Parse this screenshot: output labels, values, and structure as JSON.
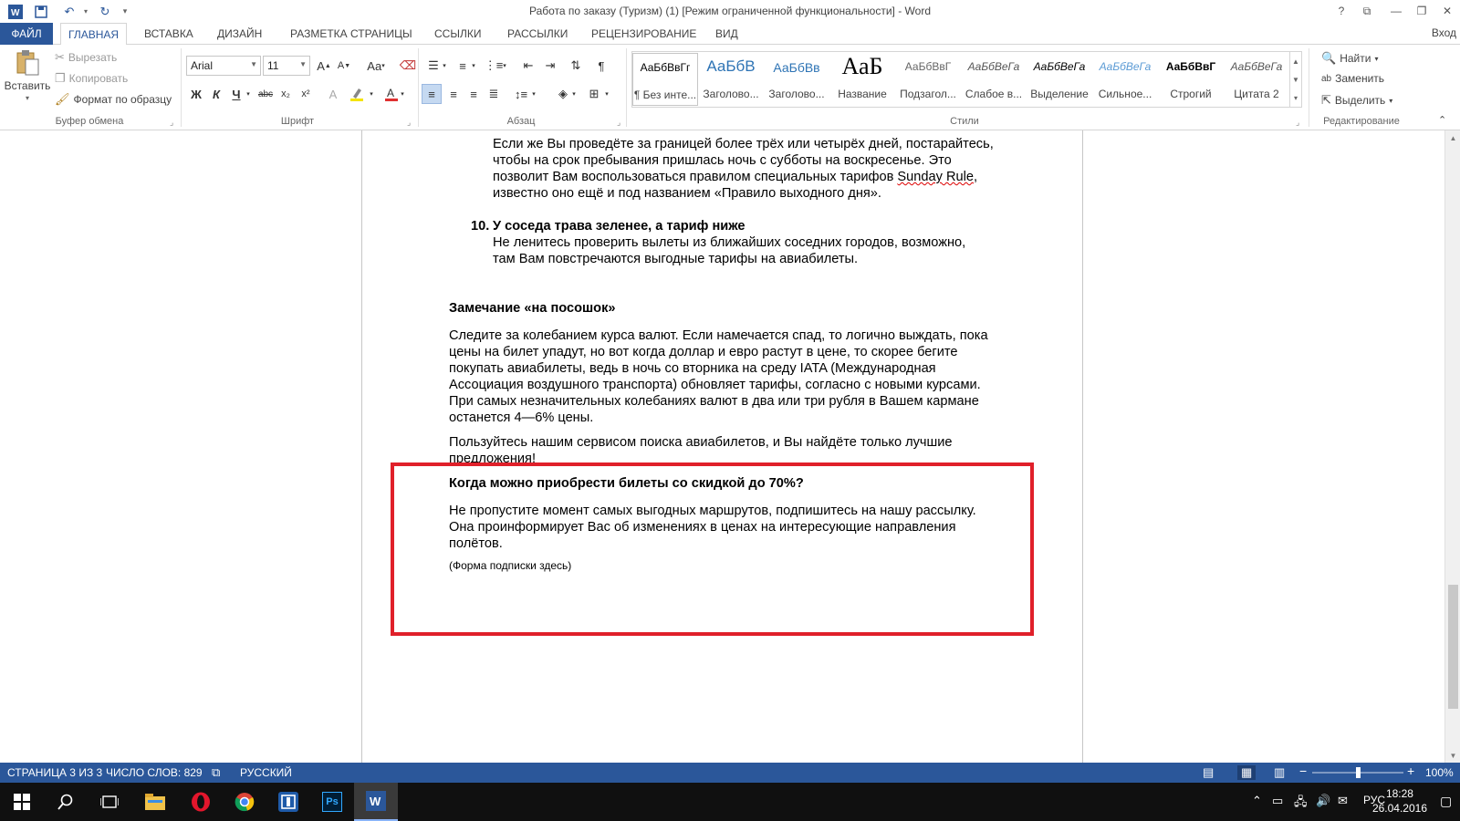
{
  "window": {
    "title": "Работа по заказу (Туризм) (1) [Режим ограниченной функциональности] - Word",
    "controls": [
      "?",
      "⧉",
      "—",
      "❐",
      "✕"
    ]
  },
  "quick_access": {
    "icons": [
      "word-icon",
      "save-icon",
      "undo-icon",
      "redo-icon",
      "customize-icon"
    ]
  },
  "tabs": {
    "file": "ФАЙЛ",
    "items": [
      "ГЛАВНАЯ",
      "ВСТАВКА",
      "ДИЗАЙН",
      "РАЗМЕТКА СТРАНИЦЫ",
      "ССЫЛКИ",
      "РАССЫЛКИ",
      "РЕЦЕНЗИРОВАНИЕ",
      "ВИД"
    ],
    "active": "ГЛАВНАЯ",
    "login": "Вход"
  },
  "ribbon": {
    "clipboard": {
      "label": "Буфер обмена",
      "paste": "Вставить",
      "cut": "Вырезать",
      "copy": "Копировать",
      "format_painter": "Формат по образцу"
    },
    "font": {
      "label": "Шрифт",
      "family": "Arial",
      "size": "11",
      "bold": "Ж",
      "italic": "К",
      "underline": "Ч",
      "strike": "abc",
      "subscript": "x₂",
      "superscript": "x²",
      "change_case": "Aa",
      "font_color_accent": "#e03030",
      "highlight_accent": "#f5e400"
    },
    "paragraph": {
      "label": "Абзац"
    },
    "styles": {
      "label": "Стили",
      "items": [
        {
          "sample": "АаБбВвГг",
          "name": "¶ Без инте..."
        },
        {
          "sample": "АаБбВ",
          "name": "Заголово..."
        },
        {
          "sample": "АаБбВв",
          "name": "Заголово..."
        },
        {
          "sample": "АаБ",
          "name": "Название"
        },
        {
          "sample": "АаБбВвГ",
          "name": "Подзагол..."
        },
        {
          "sample": "АаБбВеГа",
          "name": "Слабое в..."
        },
        {
          "sample": "АаБбВеГа",
          "name": "Выделение"
        },
        {
          "sample": "АаБбВеГа",
          "name": "Сильное..."
        },
        {
          "sample": "АаБбВвГ",
          "name": "Строгий"
        },
        {
          "sample": "АаБбВеГа",
          "name": "Цитата 2"
        }
      ]
    },
    "editing": {
      "label": "Редактирование",
      "find": "Найти",
      "replace": "Заменить",
      "select": "Выделить"
    }
  },
  "document": {
    "item9_text": "Если же Вы проведёте за границей более трёх или четырёх дней, постарайтесь, чтобы на срок пребывания пришлась ночь с субботы на воскресенье. Это позволит Вам воспользоваться правилом специальных",
    "item9_tail_prefix": "тарифов ",
    "item9_sunday": "Sunday Rule",
    "item9_tail_suffix": ", известно оно ещё и под названием «Правило выходного дня».",
    "item10_number": "10.",
    "item10_heading": "У соседа трава зеленее, а тариф ниже",
    "item10_text": "Не ленитесь проверить вылеты из ближайших соседних городов, возможно, там Вам повстречаются выгодные тарифы на авиабилеты.",
    "note_heading": "Замечание «на посошок»",
    "note_text": "Следите за колебанием курса валют. Если намечается спад, то логично выждать, пока цены на билет упадут, но вот когда доллар и евро растут в цене, то скорее бегите покупать авиабилеты, ведь в ночь со вторника на среду IATA (Международная Ассоциация воздушного транспорта) обновляет тарифы, согласно с новыми курсами. При самых незначительных колебаниях валют в два или три рубля в Вашем кармане останется 4—6% цены.",
    "service_text": "Пользуйтесь нашим сервисом поиска авиабилетов, и Вы найдёте только лучшие предложения!",
    "discount_heading": "Когда можно приобрести билеты со скидкой до 70%?",
    "discount_text": "Не пропустите момент самых выгодных маршрутов, подпишитесь на нашу рассылку. Она проинформирует Вас об изменениях в ценах на интересующие направления полётов.",
    "form_placeholder": "(Форма подписки здесь)",
    "highlight_color": "#e0202a"
  },
  "status": {
    "page": "СТРАНИЦА 3 ИЗ 3",
    "words": "ЧИСЛО СЛОВ: 829",
    "language": "РУССКИЙ",
    "zoom": "100%",
    "zoom_value": 1.0
  },
  "taskbar": {
    "apps": [
      "start-icon",
      "search-icon",
      "task-view-icon",
      "explorer-icon",
      "opera-icon",
      "chrome-icon",
      "app-icon",
      "photoshop-icon",
      "word-icon"
    ],
    "ps_label": "Ps",
    "lang": "РУС",
    "time": "18:28",
    "date": "26.04.2016"
  }
}
